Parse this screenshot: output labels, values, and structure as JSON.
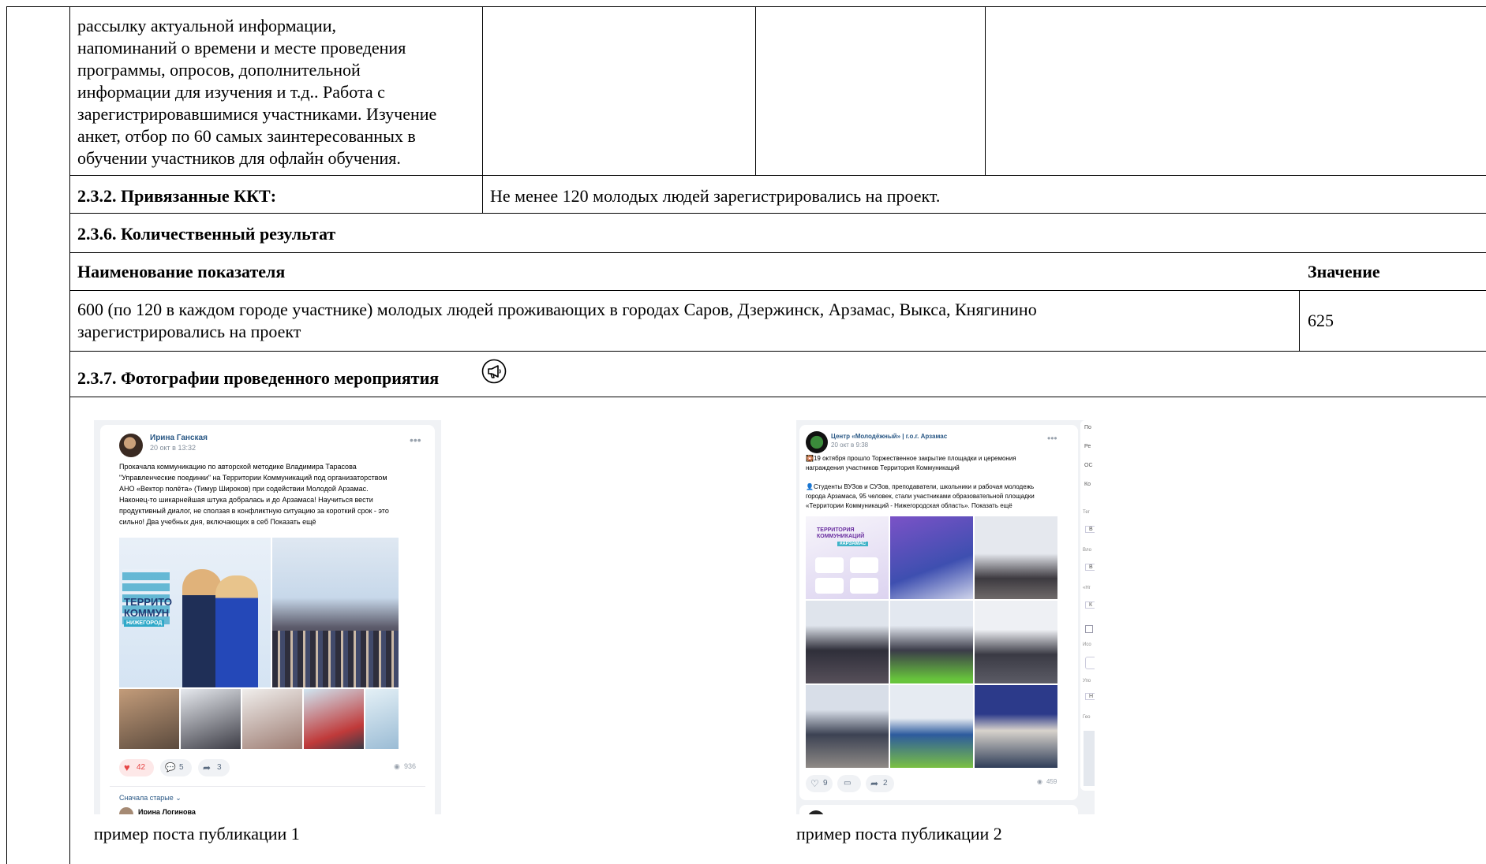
{
  "top_cell": {
    "lines": [
      "рассылку актуальной информации,",
      "напоминаний о времени и месте проведения",
      "программы, опросов, дополнительной",
      "информации для изучения и т.д.. Работа с",
      "зарегистрировавшимися участниками. Изучение",
      "анкет, отбор по 60 самых заинтересованных в",
      "обучении участников для офлайн обучения."
    ]
  },
  "kkt": {
    "label": "2.3.2. Привязанные ККТ:",
    "value": "Не менее 120 молодых людей зарегистрировались на проект."
  },
  "quant": {
    "heading": "2.3.6. Количественный результат",
    "col_name": "Наименование показателя",
    "col_value": "Значение",
    "row_line1": "600 (по 120 в каждом городе участнике) молодых людей проживающих в городах Саров, Дзержинск, Арзамас, Выкса, Княгинино",
    "row_line2": "зарегистрировались на проект",
    "row_value": "625"
  },
  "photos": {
    "heading": "2.3.7. Фотографии проведенного мероприятия",
    "caption1": "пример поста публикации 1",
    "caption2": "пример поста публикации 2"
  },
  "post1": {
    "author": "Ирина Ганская",
    "date": "20 окт в 13:32",
    "text_lines": [
      "Прокачала коммуникацию по авторской методике Владимира Тарасова",
      "\"Управленческие поединки\" на Территории Коммуникаций под организаторством",
      "АНО «Вектор полёта» (Тимур Широков) при содействии Молодой Арзамас.",
      "Наконец-то шикарнейшая штука добралась и до Арзамаса! Научиться вести",
      "продуктивный диалог, не сползая в конфликтную ситуацию за короткий срок - это",
      "сильно! Два учебных дня, включающих в себ  Показать ещё"
    ],
    "likes": "42",
    "comments": "5",
    "shares": "3",
    "views": "936",
    "sort": "Сначала старые ⌄",
    "commenter": "Ирина Логинова",
    "banner_line1": "ТЕРРИТО",
    "banner_line2": "КОММУН",
    "banner_line3": "НИЖЕГОРОД"
  },
  "post2": {
    "author": "Центр «Молодёжный» | г.о.г. Арзамас",
    "date": "20 окт в 9:38",
    "text_lines": [
      "🎇19 октября прошло Торжественное закрытие площадки и церемония",
      "награждения участников Территория Коммуникаций",
      "",
      "👤Студенты ВУЗов и СУЗов, преподаватели, школьники и рабочая молодежь",
      "города Арзамаса, 95 человек, стали участниками образовательной площадки",
      "«Территории Коммуникаций - Нижегородская область». Показать ещё"
    ],
    "likes": "9",
    "comments": "",
    "shares": "2",
    "views": "459",
    "tile_title1": "ТЕРРИТОРИЯ",
    "tile_title2": "КОММУНИКАЦИЙ",
    "tile_city": "#АРЗАМАС",
    "side_labels": [
      "По",
      "Ре",
      "ОС",
      "Ко",
      "Тег",
      "В",
      "Вло",
      "В",
      "«Нг",
      "К",
      "Исо",
      "Упо",
      "Н",
      "Гео"
    ]
  },
  "colors": {
    "border": "#000000",
    "link": "#2a5885",
    "like": "#e64646",
    "vk_bg": "#f0f2f5"
  },
  "icons": {
    "megaphone": "megaphone-icon",
    "heart": "heart-icon",
    "comment": "comment-icon",
    "share": "share-icon",
    "eye": "eye-icon"
  }
}
